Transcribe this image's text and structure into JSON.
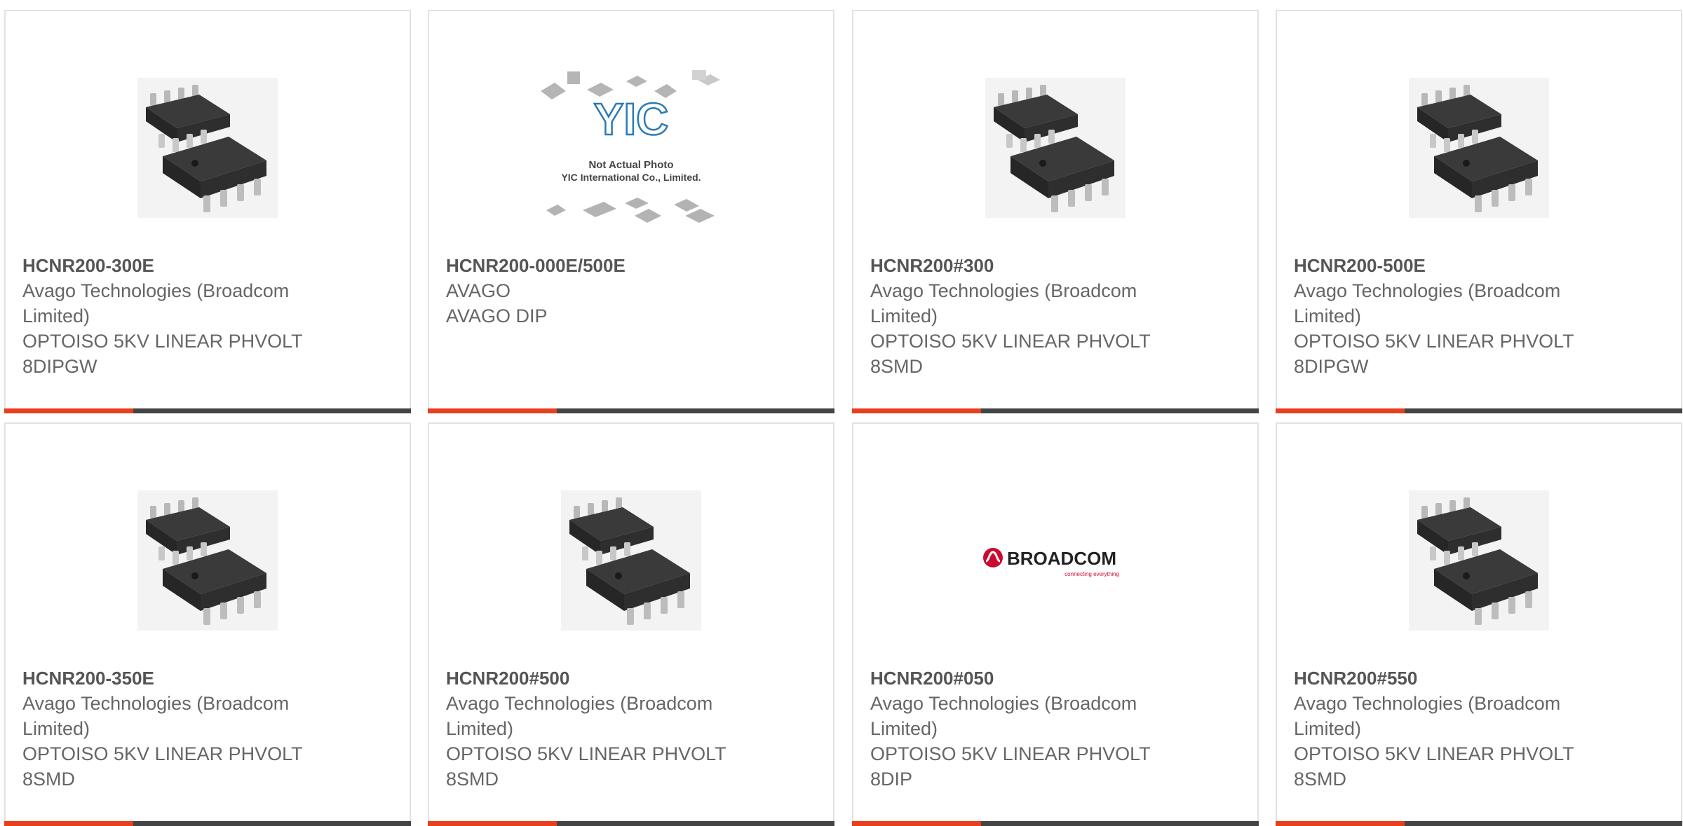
{
  "colors": {
    "accent": "#e8401c",
    "bar": "#444444",
    "border": "#e2e2e2",
    "part_text": "#555555",
    "body_text": "#666666"
  },
  "products": [
    {
      "part_number": "HCNR200-300E",
      "manufacturer": "Avago Technologies (Broadcom Limited)",
      "description": "OPTOISO 5KV LINEAR PHVOLT 8DIPGW",
      "image": "optocoupler-chip-photo"
    },
    {
      "part_number": "HCNR200-000E/500E",
      "manufacturer": "AVAGO",
      "description": "AVAGO DIP",
      "image": "yic-not-actual-photo",
      "image_text": {
        "logo": "YIC",
        "line1": "Not Actual Photo",
        "line2": "YIC International Co., Limited."
      }
    },
    {
      "part_number": "HCNR200#300",
      "manufacturer": "Avago Technologies (Broadcom Limited)",
      "description": "OPTOISO 5KV LINEAR PHVOLT 8SMD",
      "image": "optocoupler-chip-photo"
    },
    {
      "part_number": "HCNR200-500E",
      "manufacturer": "Avago Technologies (Broadcom Limited)",
      "description": "OPTOISO 5KV LINEAR PHVOLT 8DIPGW",
      "image": "optocoupler-chip-photo"
    },
    {
      "part_number": "HCNR200-350E",
      "manufacturer": "Avago Technologies (Broadcom Limited)",
      "description": "OPTOISO 5KV LINEAR PHVOLT 8SMD",
      "image": "optocoupler-chip-photo"
    },
    {
      "part_number": "HCNR200#500",
      "manufacturer": "Avago Technologies (Broadcom Limited)",
      "description": "OPTOISO 5KV LINEAR PHVOLT 8SMD",
      "image": "optocoupler-chip-photo"
    },
    {
      "part_number": "HCNR200#050",
      "manufacturer": "Avago Technologies (Broadcom Limited)",
      "description": "OPTOISO 5KV LINEAR PHVOLT 8DIP",
      "image": "broadcom-logo",
      "image_text": {
        "logo": "BROADCOM",
        "tagline": "connecting everything"
      }
    },
    {
      "part_number": "HCNR200#550",
      "manufacturer": "Avago Technologies (Broadcom Limited)",
      "description": "OPTOISO 5KV LINEAR PHVOLT 8SMD",
      "image": "optocoupler-chip-photo"
    }
  ]
}
